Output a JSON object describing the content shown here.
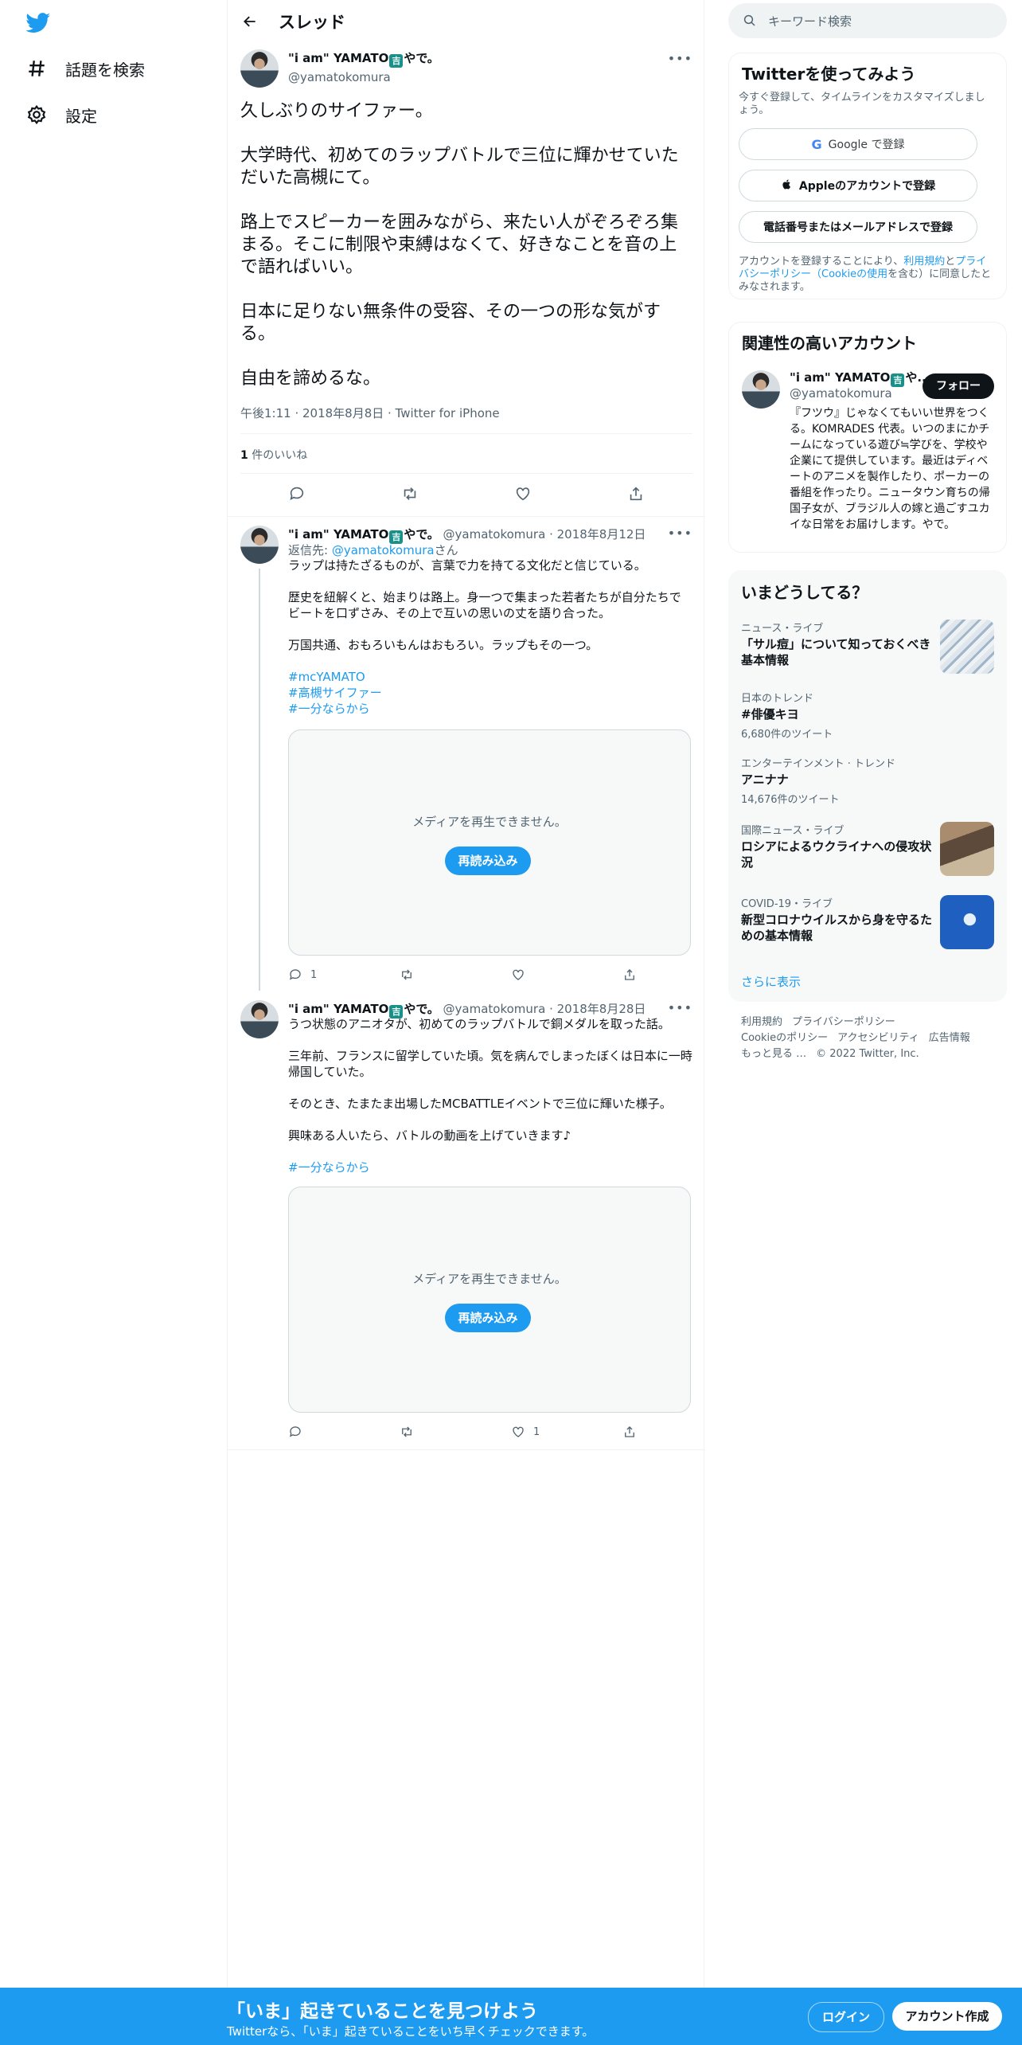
{
  "nav": {
    "items": [
      {
        "label": "話題を検索",
        "icon": "hashtag-icon"
      },
      {
        "label": "設定",
        "icon": "gear-icon"
      }
    ]
  },
  "header": {
    "title": "スレッド"
  },
  "main_tweet": {
    "name_prefix": "\"i am\" YAMATO",
    "name_badge": "吉",
    "name_suffix": "やで。",
    "handle": "@yamatokomura",
    "text": "久しぶりのサイファー。\n\n大学時代、初めてのラップバトルで三位に輝かせていただいた高槻にて。\n\n路上でスピーカーを囲みながら、来たい人がぞろぞろ集まる。そこに制限や束縛はなくて、好きなことを音の上で語ればいい。\n\n日本に足りない無条件の受容、その一つの形な気がする。\n\n自由を諦めるな。",
    "meta": "午後1:11 · 2018年8月8日 · Twitter for iPhone",
    "likes_count": "1",
    "likes_label": "件のいいね"
  },
  "replies": [
    {
      "name_prefix": "\"i am\" YAMATO",
      "name_badge": "吉",
      "name_suffix": "やで。",
      "handle": "@yamatokomura",
      "date": "2018年8月12日",
      "reply_to_label": "返信先: ",
      "reply_to_handle": "@yamatokomura",
      "reply_to_suffix": "さん",
      "text": "ラップは持たざるものが、言葉で力を持てる文化だと信じている。\n\n歴史を紐解くと、始まりは路上。身一つで集まった若者たちが自分たちでビートを口ずさみ、その上で互いの思いの丈を語り合った。\n\n万国共通、おもろいもんはおもろい。ラップもその一つ。",
      "hashtags": [
        "#mcYAMATO",
        "#高槻サイファー",
        "#一分ならから"
      ],
      "media_message": "メディアを再生できません。",
      "media_button": "再読み込み",
      "reply_count": "1",
      "retweet_count": "",
      "like_count": ""
    },
    {
      "name_prefix": "\"i am\" YAMATO",
      "name_badge": "吉",
      "name_suffix": "やで。",
      "handle": "@yamatokomura",
      "date": "2018年8月28日",
      "text": "うつ状態のアニオタが、初めてのラップバトルで銅メダルを取った話。\n\n三年前、フランスに留学していた頃。気を病んでしまったぼくは日本に一時帰国していた。\n\nそのとき、たまたま出場したMCBATTLEイベントで三位に輝いた様子。\n\n興味ある人いたら、バトルの動画を上げていきます♪",
      "hashtags": [
        "#一分ならから"
      ],
      "media_message": "メディアを再生できません。",
      "media_button": "再読み込み",
      "reply_count": "",
      "retweet_count": "",
      "like_count": "1"
    }
  ],
  "sidebar": {
    "search_placeholder": "キーワード検索",
    "signup": {
      "title": "Twitterを使ってみよう",
      "subtitle": "今すぐ登録して、タイムラインをカスタマイズしましょう。",
      "google": "Google で登録",
      "apple": "Appleのアカウントで登録",
      "phone": "電話番号またはメールアドレスで登録",
      "terms_a": "アカウントを登録することにより、",
      "terms_link1": "利用規約",
      "terms_b": "と",
      "terms_link2": "プライバシーポリシー（Cookieの使用",
      "terms_c": "を含む）に同意したとみなされます。"
    },
    "related": {
      "title": "関連性の高いアカウント",
      "name": "\"i am\" YAMATO",
      "name_badge": "吉",
      "name_suffix": "や...",
      "handle": "@yamatokomura",
      "follow": "フォロー",
      "bio": "『フツウ』じゃなくてもいい世界をつくる。KOMRADES 代表。いつのまにかチームになっている遊び≒学びを、学校や企業にて提供しています。最近はディベートのアニメを製作したり、ポーカーの番組を作ったり。ニュータウン育ちの帰国子女が、ブラジル人の嫁と過ごすユカイな日常をお届けします。やで。"
    },
    "trends": {
      "title": "いまどうしてる？",
      "items": [
        {
          "category": "ニュース・ライブ",
          "title": "「サル痘」について知っておくべき基本情報",
          "count": ""
        },
        {
          "category": "日本のトレンド",
          "title": "#俳優キヨ",
          "count": "6,680件のツイート"
        },
        {
          "category": "エンターテインメント · トレンド",
          "title": "アニナナ",
          "count": "14,676件のツイート"
        },
        {
          "category": "国際ニュース・ライブ",
          "title": "ロシアによるウクライナへの侵攻状況",
          "count": ""
        },
        {
          "category": "COVID-19・ライブ",
          "title": "新型コロナウイルスから身を守るための基本情報",
          "count": ""
        }
      ],
      "show_more": "さらに表示"
    },
    "footer": {
      "line1": [
        "利用規約",
        "プライバシーポリシー"
      ],
      "line2": [
        "Cookieのポリシー",
        "アクセシビリティ",
        "広告情報"
      ],
      "line3": [
        "もっと見る …",
        "© 2022 Twitter, Inc."
      ]
    }
  },
  "bottom_bar": {
    "title": "「いま」起きていることを見つけよう",
    "subtitle": "Twitterなら、「いま」起きていることをいち早くチェックできます。",
    "login": "ログイン",
    "signup": "アカウント作成"
  },
  "colors": {
    "accent": "#1d9bf0",
    "text": "#0f1419",
    "muted": "#536471",
    "border": "#eff3f4"
  }
}
